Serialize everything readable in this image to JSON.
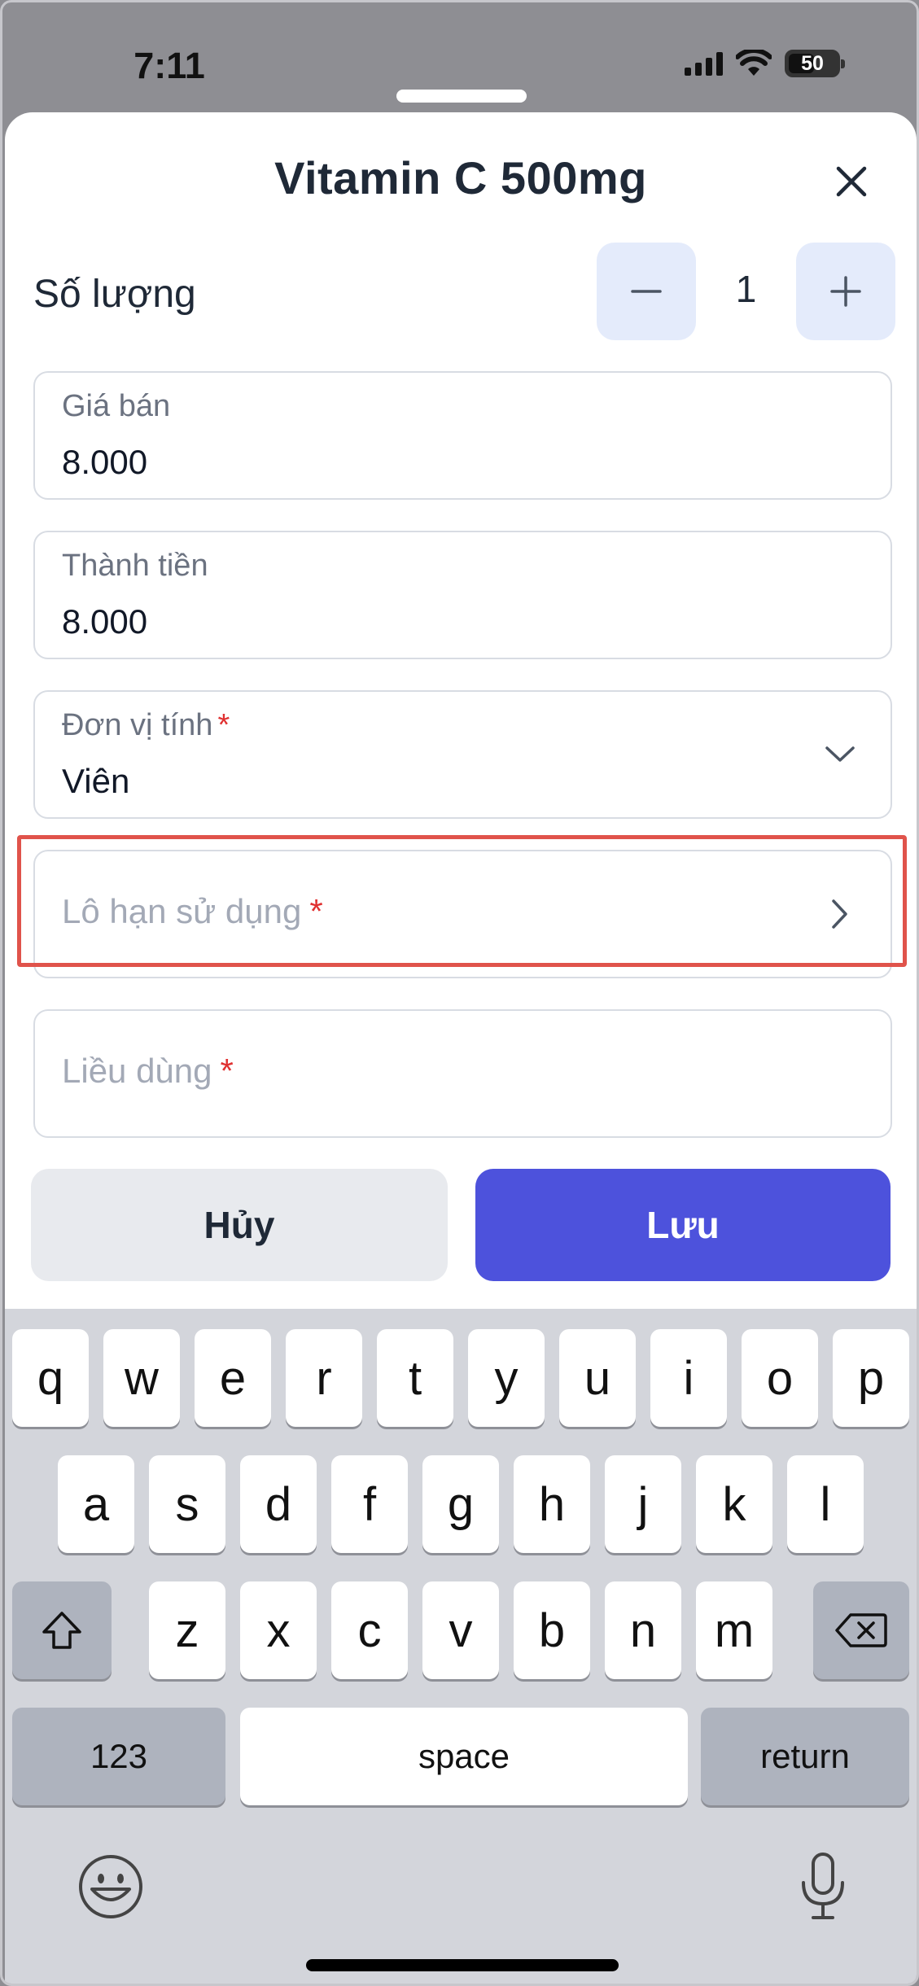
{
  "status_bar": {
    "time": "7:11",
    "battery_percent": "50",
    "battery_level": 0.5
  },
  "sheet": {
    "title": "Vitamin C 500mg",
    "close_icon": "close-icon"
  },
  "quantity": {
    "label": "Số lượng",
    "value": "1"
  },
  "fields": {
    "price": {
      "label": "Giá bán",
      "value": "8.000"
    },
    "total": {
      "label": "Thành tiền",
      "value": "8.000"
    },
    "unit": {
      "label": "Đơn vị tính",
      "required": "*",
      "value": "Viên",
      "icon": "chevron-down-icon"
    },
    "batch_expiry": {
      "placeholder": "Lô hạn sử dụng",
      "required": "*",
      "icon": "chevron-right-icon"
    },
    "dosage": {
      "placeholder": "Liều dùng",
      "required": "*"
    }
  },
  "actions": {
    "cancel_label": "Hủy",
    "save_label": "Lưu"
  },
  "keyboard": {
    "row1": [
      "q",
      "w",
      "e",
      "r",
      "t",
      "y",
      "u",
      "i",
      "o",
      "p"
    ],
    "row2": [
      "a",
      "s",
      "d",
      "f",
      "g",
      "h",
      "j",
      "k",
      "l"
    ],
    "row3": [
      "z",
      "x",
      "c",
      "v",
      "b",
      "n",
      "m"
    ],
    "numbers_key": "123",
    "space_key": "space",
    "return_key": "return",
    "icons": [
      "shift-icon",
      "delete-icon",
      "emoji-icon",
      "microphone-icon"
    ]
  },
  "colors": {
    "accent": "#4d52dc",
    "highlight": "#e0534b",
    "required": "#e03131",
    "stepper_bg": "#e4ebfb"
  }
}
